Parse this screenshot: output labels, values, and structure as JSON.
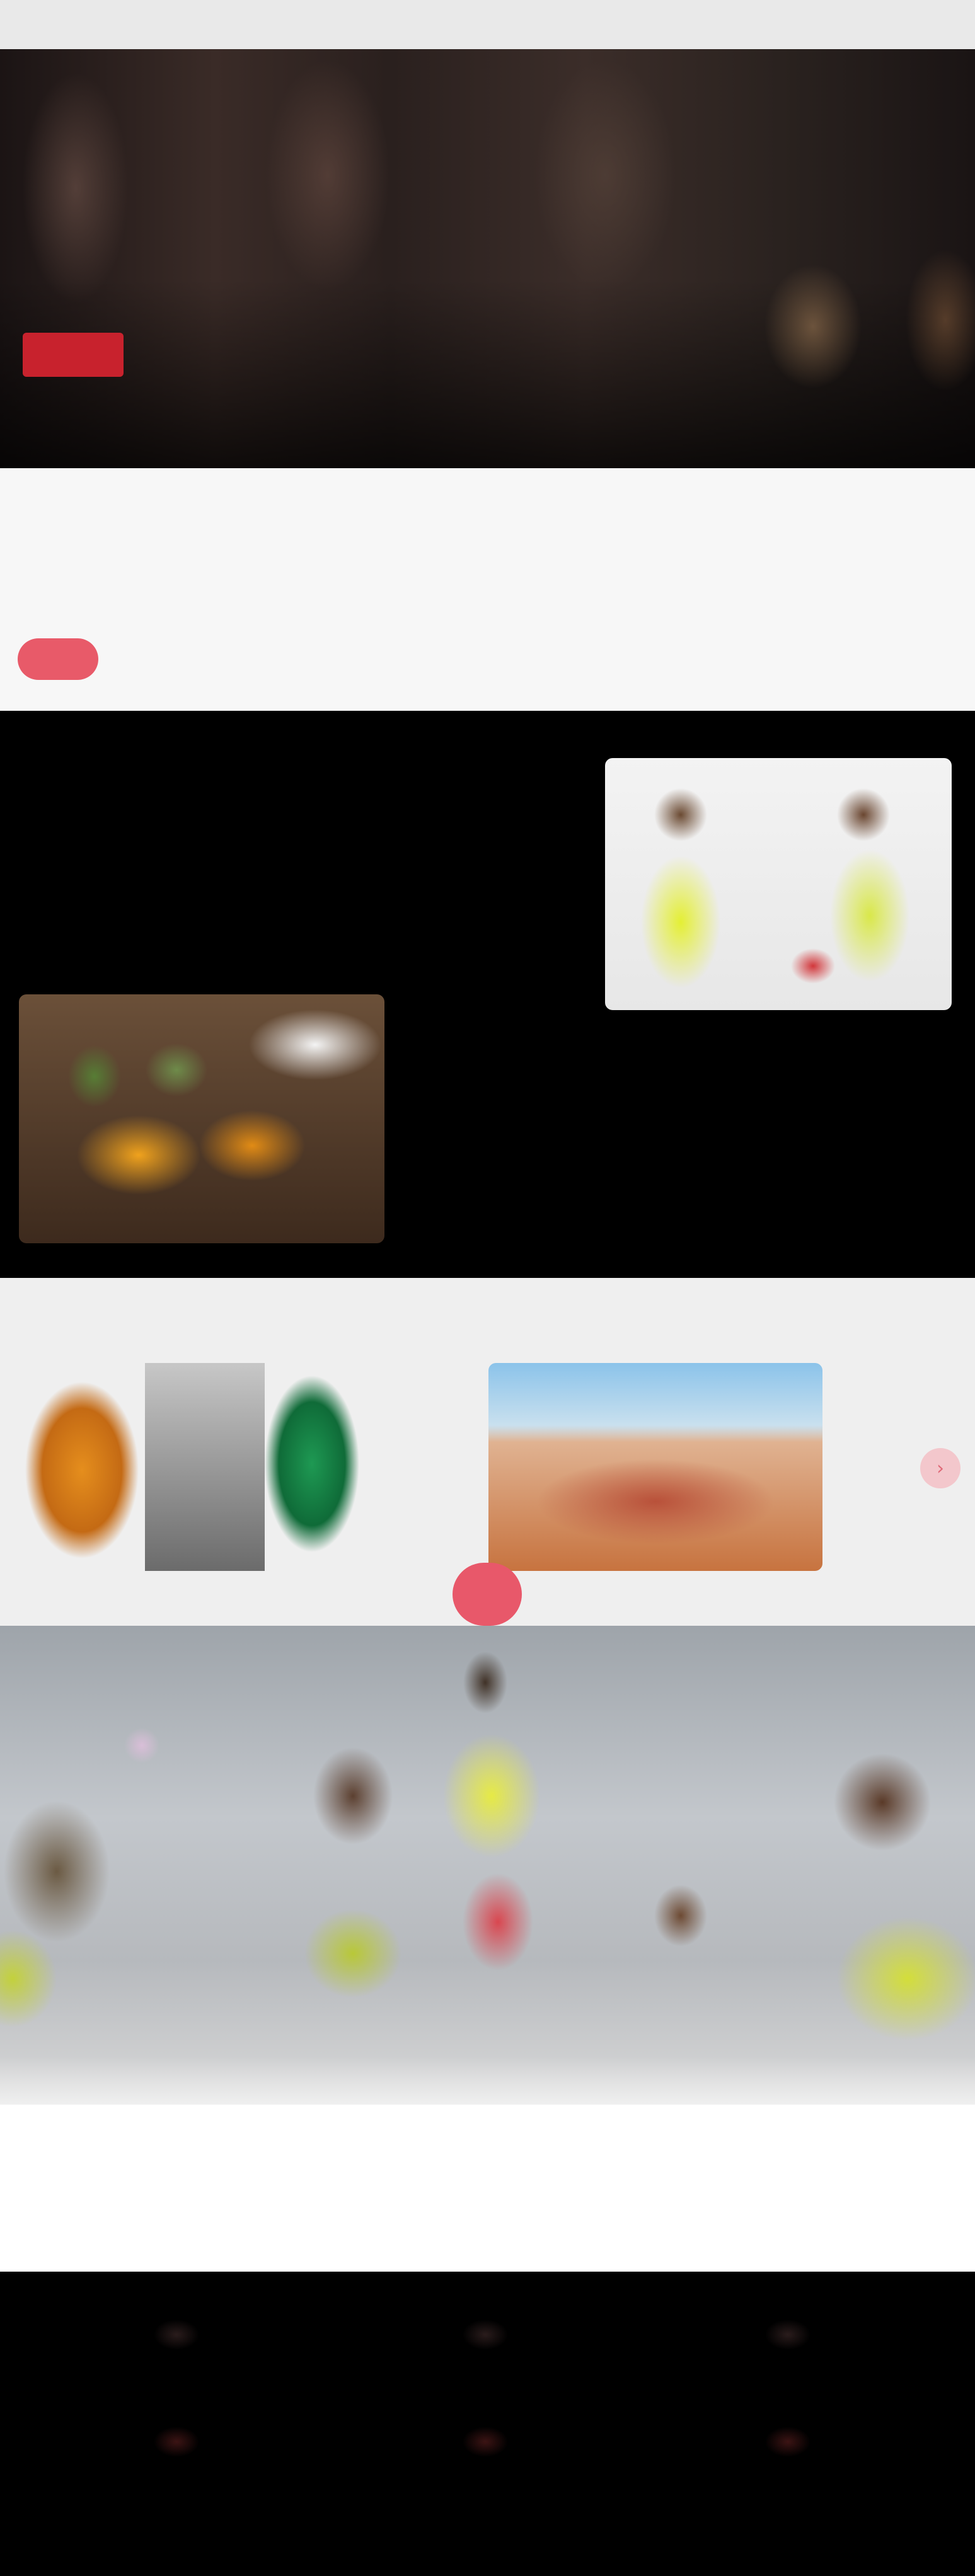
{
  "colors": {
    "accent": "#c8222d",
    "accent_light": "#e8586a",
    "dark_band": "#000000",
    "light_band": "#efefef"
  },
  "hero": {
    "title": "",
    "cta_label": ""
  },
  "intro": {
    "heading": "",
    "text": "",
    "badge_label": ""
  },
  "news": {
    "item1_title": "",
    "item1_text": "",
    "item2_title": "",
    "item2_text": ""
  },
  "projects": {
    "heading": "",
    "next_icon": "chevron-right-icon",
    "badge_label": ""
  },
  "signup": {
    "heading": "",
    "text": ""
  },
  "footer": {
    "col1_label": "",
    "col2_label": "",
    "col3_label": "",
    "copyright": ""
  }
}
